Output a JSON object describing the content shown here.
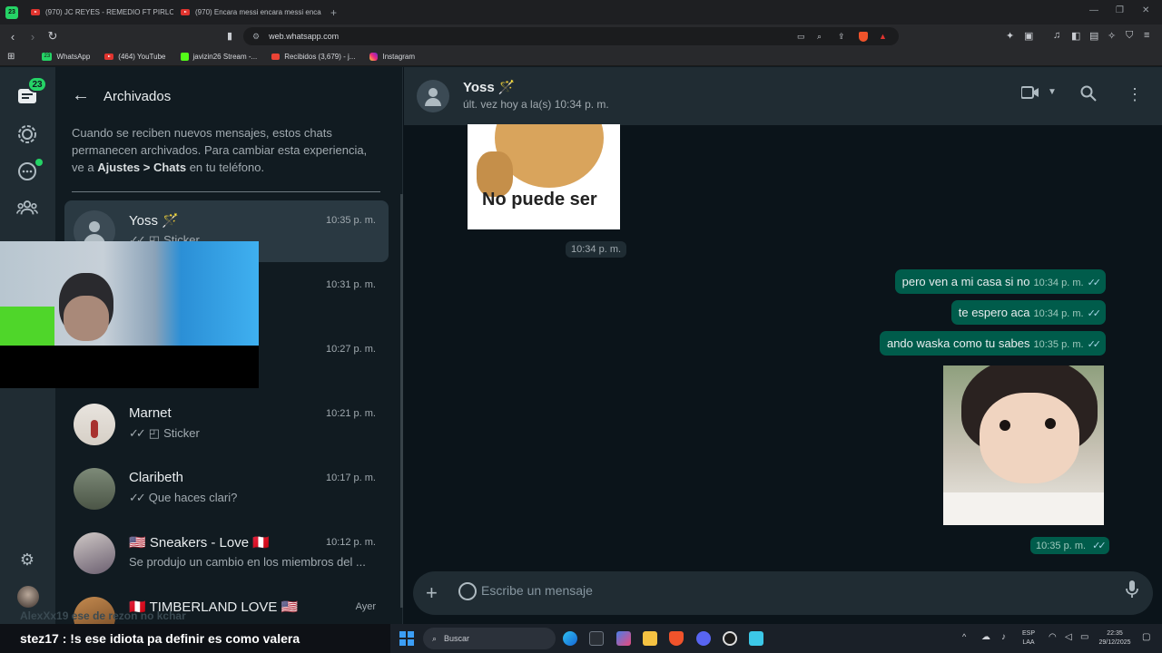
{
  "browser": {
    "tabs": [
      {
        "badge": "23",
        "title": ""
      },
      {
        "title": "(970) JC REYES - REMEDIO FT PIRLO"
      },
      {
        "title": "(970) Encara messi encara messi enca"
      }
    ],
    "url": "web.whatsapp.com",
    "bookmarks": [
      {
        "label": "WhatsApp",
        "badge": "23"
      },
      {
        "label": "(464) YouTube"
      },
      {
        "label": "javizin26 Stream -..."
      },
      {
        "label": "Recibidos (3,679) - j..."
      },
      {
        "label": "Instagram"
      }
    ]
  },
  "rail": {
    "unread_badge": "23"
  },
  "archived": {
    "title": "Archivados",
    "note_prefix": "Cuando se reciben nuevos mensajes, estos chats permanecen archivados. Para cambiar esta experiencia, ve a ",
    "note_bold": "Ajustes > Chats",
    "note_suffix": " en tu teléfono."
  },
  "chats": [
    {
      "name": "Yoss 🪄",
      "time": "10:35 p. m.",
      "preview": "Sticker",
      "ticks": "✓✓"
    },
    {
      "name": "",
      "time": "10:31 p. m.",
      "preview": ""
    },
    {
      "name": "",
      "time": "10:27 p. m.",
      "preview": ""
    },
    {
      "name": "Marnet",
      "time": "10:21 p. m.",
      "preview": "Sticker",
      "ticks": "✓✓"
    },
    {
      "name": "Claribeth",
      "time": "10:17 p. m.",
      "preview": "Que haces clari?",
      "ticks": "✓✓"
    },
    {
      "name": "🇺🇸 Sneakers  - Love  🇵🇪",
      "time": "10:12 p. m.",
      "preview": "Se produjo un cambio en los miembros del ..."
    },
    {
      "name": "🇵🇪 TIMBERLAND LOVE 🇺🇸",
      "time": "Ayer",
      "preview": ""
    }
  ],
  "conversation": {
    "name": "Yoss 🪄",
    "status": "últ. vez hoy a la(s) 10:34 p. m.",
    "sticker1_text": "No puede ser",
    "sticker1_time": "10:34 p. m.",
    "messages": [
      {
        "text": "pero ven a mi casa si no",
        "time": "10:34 p. m."
      },
      {
        "text": "te espero aca",
        "time": "10:34 p. m."
      },
      {
        "text": "ando waska como tu sabes",
        "time": "10:35 p. m."
      }
    ],
    "sticker2_time": "10:35 p. m.",
    "composer_placeholder": "Escribe un mensaje"
  },
  "stream_chat": {
    "ghost_line": "AlexXx19 ese de rezon no kchar",
    "line": "stez17 : !s ese idiota pa definir es como valera"
  },
  "taskbar": {
    "search": "Buscar",
    "lang": "ESP",
    "lang2": "LAA",
    "time": "22:35",
    "date": "29/12/2025"
  },
  "colors": {
    "accent": "#25d366",
    "bubble_out": "#005c4b",
    "panel": "#202c33",
    "background": "#0b141a"
  }
}
